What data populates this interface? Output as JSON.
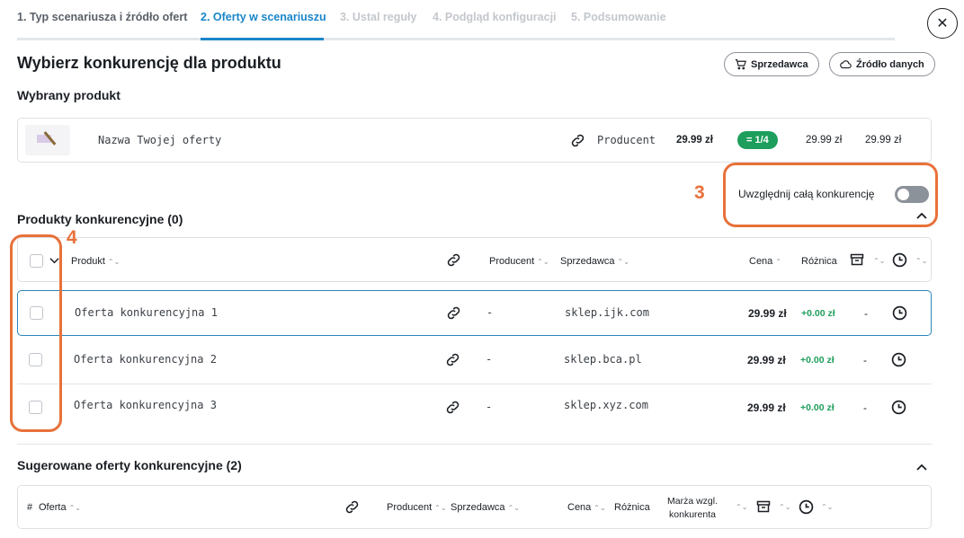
{
  "steps": [
    {
      "label": "1. Typ scenariusza i źródło ofert"
    },
    {
      "label": "2. Oferty w scenariuszu"
    },
    {
      "label": "3. Ustal reguły"
    },
    {
      "label": "4. Podgląd konfiguracji"
    },
    {
      "label": "5. Podsumowanie"
    }
  ],
  "header": {
    "title": "Wybierz konkurencję dla produktu",
    "seller_button": "Sprzedawca",
    "source_button": "Źródło danych"
  },
  "selected_product": {
    "section_label": "Wybrany produkt",
    "name": "Nazwa Twojej oferty",
    "producer": "Producent",
    "price": "29.99 zł",
    "badge": "= 1/4",
    "price_2": "29.99 zł",
    "price_3": "29.99 zł"
  },
  "annotations": {
    "toggle_marker": "3",
    "checkbox_marker": "4"
  },
  "include_all": {
    "label": "Uwzględnij całą konkurencję",
    "enabled": false
  },
  "competitors": {
    "section_label": "Produkty konkurencyjne (0)",
    "columns": {
      "product": "Produkt",
      "producer": "Producent",
      "seller": "Sprzedawca",
      "price": "Cena",
      "difference": "Różnica"
    },
    "rows": [
      {
        "name": "Oferta konkurencyjna 1",
        "producer": "-",
        "seller": "sklep.ijk.com",
        "price": "29.99 zł",
        "difference": "+0.00 zł",
        "extra": "-"
      },
      {
        "name": "Oferta konkurencyjna 2",
        "producer": "-",
        "seller": "sklep.bca.pl",
        "price": "29.99 zł",
        "difference": "+0.00 zł",
        "extra": "-"
      },
      {
        "name": "Oferta konkurencyjna 3",
        "producer": "-",
        "seller": "sklep.xyz.com",
        "price": "29.99 zł",
        "difference": "+0.00 zł",
        "extra": "-"
      }
    ]
  },
  "suggested": {
    "section_label": "Sugerowane oferty konkurencyjne (2)",
    "columns": {
      "hash": "#",
      "offer": "Oferta",
      "producer": "Producent",
      "seller": "Sprzedawca",
      "price": "Cena",
      "difference": "Różnica",
      "margin_1": "Marża wzgl.",
      "margin_2": "konkurenta"
    }
  },
  "colors": {
    "accent": "#1a86c9",
    "annotation": "#e8713a",
    "positive": "#1e9e5c"
  }
}
